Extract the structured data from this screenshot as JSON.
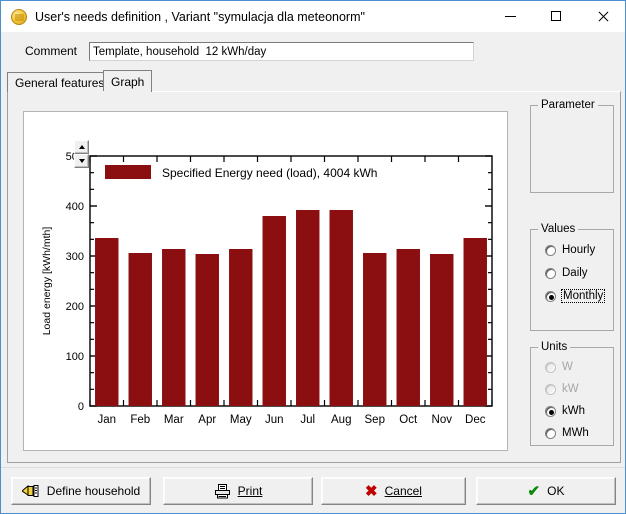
{
  "window": {
    "title": "User's needs definition , Variant  \"symulacja dla meteonorm\"",
    "icon": "household-gold-icon",
    "minimize_label": "Minimize",
    "maximize_label": "Maximize",
    "close_label": "Close"
  },
  "comment": {
    "label": "Comment",
    "value": "Template, household  12 kWh/day",
    "placeholder": ""
  },
  "tabs": [
    {
      "label": "General features",
      "active": false
    },
    {
      "label": "Graph",
      "active": true
    }
  ],
  "parameter_group": {
    "title": "Parameter"
  },
  "values_group": {
    "title": "Values",
    "options": [
      {
        "label": "Hourly",
        "selected": false,
        "disabled": false,
        "focused": false
      },
      {
        "label": "Daily",
        "selected": false,
        "disabled": false,
        "focused": false
      },
      {
        "label": "Monthly",
        "selected": true,
        "disabled": false,
        "focused": true
      }
    ]
  },
  "units_group": {
    "title": "Units",
    "options": [
      {
        "label": "W",
        "selected": false,
        "disabled": true,
        "focused": false
      },
      {
        "label": "kW",
        "selected": false,
        "disabled": true,
        "focused": false
      },
      {
        "label": "kWh",
        "selected": true,
        "disabled": false,
        "focused": false
      },
      {
        "label": "MWh",
        "selected": false,
        "disabled": false,
        "focused": false
      }
    ]
  },
  "buttons": {
    "define_household": "Define household",
    "print": "Print",
    "cancel": "Cancel",
    "ok": "OK"
  },
  "spinner": {
    "up": "increase-scale",
    "down": "decrease-scale"
  },
  "chart_data": {
    "type": "bar",
    "title": "",
    "legend": "Specified Energy need (load),  4004 kWh",
    "legend_position": "top-left-inside",
    "legend_color": "#8b0f11",
    "series_name": "Specified Energy need (load)",
    "total_label": "4004 kWh",
    "total": 4004,
    "categories": [
      "Jan",
      "Feb",
      "Mar",
      "Apr",
      "May",
      "Jun",
      "Jul",
      "Aug",
      "Sep",
      "Oct",
      "Nov",
      "Dec"
    ],
    "values": [
      336,
      306,
      314,
      304,
      314,
      380,
      392,
      392,
      306,
      314,
      304,
      336
    ],
    "xlabel": "",
    "ylabel": "Load energy  [kWh/mth]",
    "ylim": [
      0,
      500
    ],
    "yticks": [
      0,
      100,
      200,
      300,
      400,
      500
    ],
    "ytick_labels": [
      "0",
      "100",
      "200",
      "300",
      "400",
      "500"
    ],
    "minor_ticks_per_interval": 2,
    "grid": false,
    "bar_color": "#8b0f11",
    "axis_color": "#000000",
    "plot_bg": "#ffffff"
  }
}
